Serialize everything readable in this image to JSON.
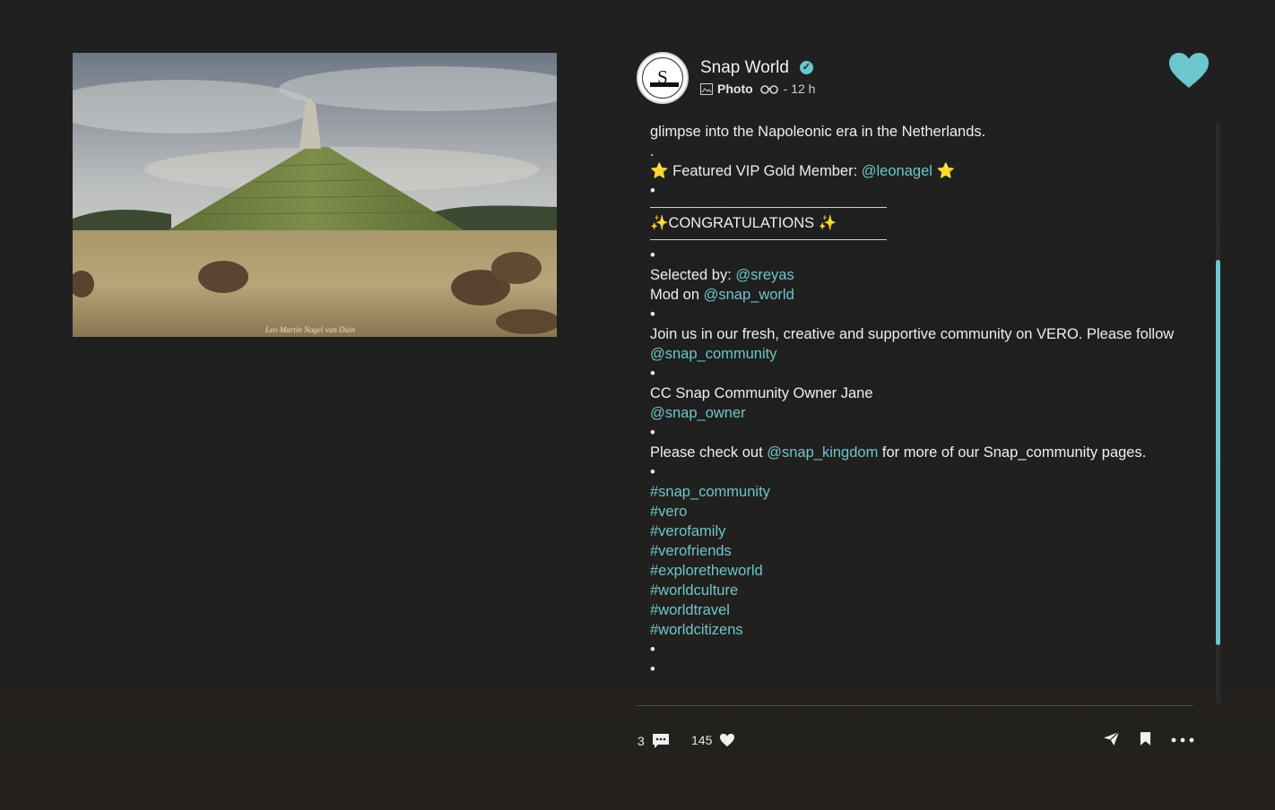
{
  "post": {
    "account_name": "Snap World",
    "avatar_letter": "S",
    "post_type": "Photo",
    "time_ago": "- 12 h",
    "photo_watermark": "Leo Martin Nagel van Duin"
  },
  "caption": {
    "intro": "glimpse into the Napoleonic era in the Netherlands.",
    "dot": ".",
    "bullet": "•",
    "featured_prefix": "⭐ Featured VIP Gold Member: ",
    "featured_mention": "@leonagel",
    "featured_suffix": " ⭐",
    "congrats": "✨CONGRATULATIONS ✨",
    "selected_prefix": "Selected by: ",
    "selected_mention": "@sreyas",
    "mod_prefix": "Mod on ",
    "mod_mention": "@snap_world",
    "join_text": "Join us in our fresh, creative and supportive community on VERO. Please follow ",
    "join_mention": "@snap_community",
    "owner_text": "CC Snap Community Owner Jane",
    "owner_mention": "@snap_owner",
    "check_prefix": "Please check out ",
    "check_mention": "@snap_kingdom",
    "check_suffix": " for more of our Snap_community pages.",
    "hashtags": [
      "#snap_community",
      "#vero",
      "#verofamily",
      "#verofriends",
      "#exploretheworld",
      "#worldculture",
      "#worldtravel",
      "#worldcitizens"
    ]
  },
  "footer": {
    "comment_count": "3",
    "like_count": "145"
  },
  "colors": {
    "accent": "#6cc6cd",
    "background": "#1f1f1f"
  },
  "icons": [
    "verified-icon",
    "photo-type-icon",
    "binoculars-icon",
    "heart-icon",
    "comment-icon",
    "like-icon",
    "share-icon",
    "bookmark-icon",
    "more-icon"
  ]
}
